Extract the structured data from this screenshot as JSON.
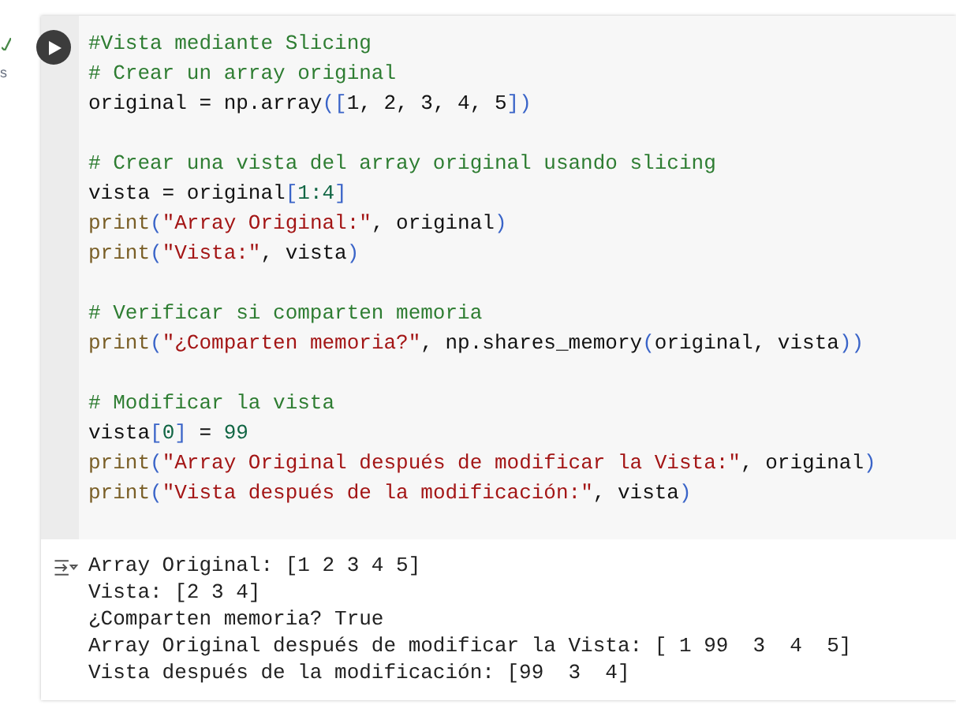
{
  "gutter": {
    "run_status": "s"
  },
  "code_blocks": [
    [
      [
        {
          "kind": "comment",
          "text": "#Vista mediante Slicing"
        }
      ],
      [
        {
          "kind": "comment",
          "text": "# Crear un array original"
        }
      ],
      [
        {
          "kind": "plain",
          "text": "original = np.array"
        },
        {
          "kind": "bracket",
          "text": "(["
        },
        {
          "kind": "plain",
          "text": "1, 2, 3, 4, 5"
        },
        {
          "kind": "bracket",
          "text": "])"
        }
      ]
    ],
    [
      [
        {
          "kind": "comment",
          "text": "# Crear una vista del array original usando slicing"
        }
      ],
      [
        {
          "kind": "plain",
          "text": "vista = original"
        },
        {
          "kind": "bracket",
          "text": "["
        },
        {
          "kind": "number",
          "text": "1:4"
        },
        {
          "kind": "bracket",
          "text": "]"
        }
      ],
      [
        {
          "kind": "func",
          "text": "print"
        },
        {
          "kind": "bracket",
          "text": "("
        },
        {
          "kind": "string",
          "text": "\"Array Original:\""
        },
        {
          "kind": "plain",
          "text": ", original"
        },
        {
          "kind": "bracket",
          "text": ")"
        }
      ],
      [
        {
          "kind": "func",
          "text": "print"
        },
        {
          "kind": "bracket",
          "text": "("
        },
        {
          "kind": "string",
          "text": "\"Vista:\""
        },
        {
          "kind": "plain",
          "text": ", vista"
        },
        {
          "kind": "bracket",
          "text": ")"
        }
      ]
    ],
    [
      [
        {
          "kind": "comment",
          "text": "# Verificar si comparten memoria"
        }
      ],
      [
        {
          "kind": "func",
          "text": "print"
        },
        {
          "kind": "bracket",
          "text": "("
        },
        {
          "kind": "string",
          "text": "\"¿Comparten memoria?\""
        },
        {
          "kind": "plain",
          "text": ", np.shares_memory"
        },
        {
          "kind": "bracket",
          "text": "("
        },
        {
          "kind": "plain",
          "text": "original, vista"
        },
        {
          "kind": "bracket",
          "text": "))"
        }
      ]
    ],
    [
      [
        {
          "kind": "comment",
          "text": "# Modificar la vista"
        }
      ],
      [
        {
          "kind": "plain",
          "text": "vista"
        },
        {
          "kind": "bracket",
          "text": "["
        },
        {
          "kind": "number",
          "text": "0"
        },
        {
          "kind": "bracket",
          "text": "]"
        },
        {
          "kind": "plain",
          "text": " = "
        },
        {
          "kind": "number",
          "text": "99"
        }
      ],
      [
        {
          "kind": "func",
          "text": "print"
        },
        {
          "kind": "bracket",
          "text": "("
        },
        {
          "kind": "string",
          "text": "\"Array Original después de modificar la Vista:\""
        },
        {
          "kind": "plain",
          "text": ", original"
        },
        {
          "kind": "bracket",
          "text": ")"
        }
      ],
      [
        {
          "kind": "func",
          "text": "print"
        },
        {
          "kind": "bracket",
          "text": "("
        },
        {
          "kind": "string",
          "text": "\"Vista después de la modificación:\""
        },
        {
          "kind": "plain",
          "text": ", vista"
        },
        {
          "kind": "bracket",
          "text": ")"
        }
      ]
    ]
  ],
  "output_lines": [
    "Array Original: [1 2 3 4 5]",
    "Vista: [2 3 4]",
    "¿Comparten memoria? True",
    "Array Original después de modificar la Vista: [ 1 99  3  4  5]",
    "Vista después de la modificación: [99  3  4]"
  ]
}
